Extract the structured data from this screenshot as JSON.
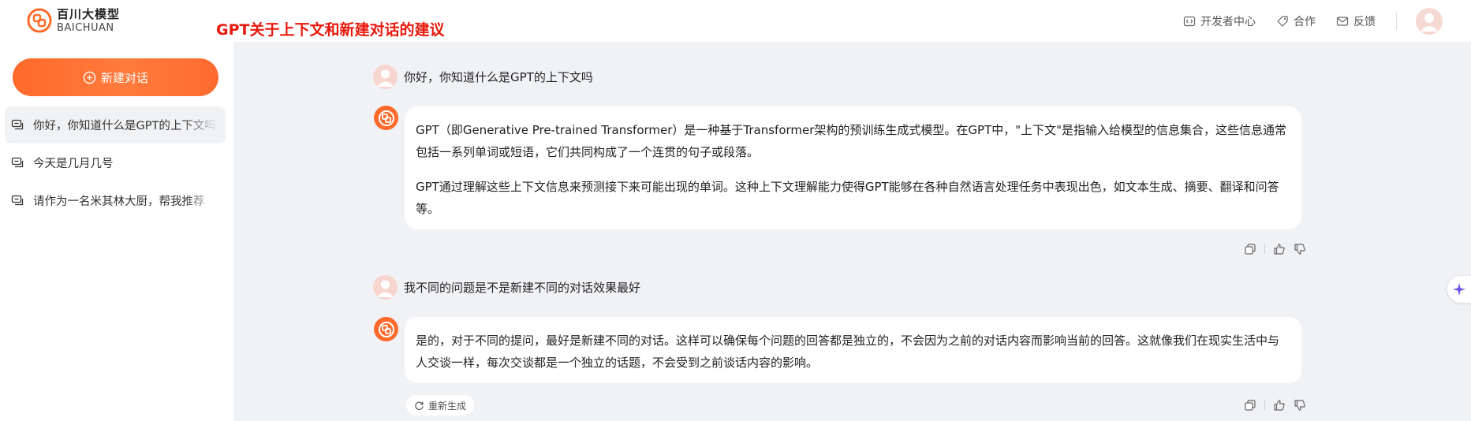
{
  "app": {
    "logo_cn": "百川大模型",
    "logo_en": "BAICHUAN",
    "brand_color": "#ff6a2b"
  },
  "page_title": "GPT关于上下文和新建对话的建议",
  "header": {
    "links": [
      {
        "label": "开发者中心",
        "icon": "code-icon"
      },
      {
        "label": "合作",
        "icon": "tag-icon"
      },
      {
        "label": "反馈",
        "icon": "mail-icon"
      }
    ]
  },
  "sidebar": {
    "new_chat_label": "新建对话",
    "conversations": [
      {
        "label": "你好，你知道什么是GPT的上下文吗",
        "active": true
      },
      {
        "label": "今天是几月几号",
        "active": false
      },
      {
        "label": "请作为一名米其林大厨，帮我推荐",
        "active": false
      }
    ]
  },
  "messages": [
    {
      "role": "user",
      "text": "你好，你知道什么是GPT的上下文吗"
    },
    {
      "role": "bot",
      "paragraphs": [
        "GPT（即Generative Pre-trained Transformer）是一种基于Transformer架构的预训练生成式模型。在GPT中，\"上下文\"是指输入给模型的信息集合，这些信息通常包括一系列单词或短语，它们共同构成了一个连贯的句子或段落。",
        "GPT通过理解这些上下文信息来预测接下来可能出现的单词。这种上下文理解能力使得GPT能够在各种自然语言处理任务中表现出色，如文本生成、摘要、翻译和问答等。"
      ]
    },
    {
      "role": "user",
      "text": "我不同的问题是不是新建不同的对话效果最好"
    },
    {
      "role": "bot",
      "paragraphs": [
        "是的，对于不同的提问，最好是新建不同的对话。这样可以确保每个问题的回答都是独立的，不会因为之前的对话内容而影响当前的回答。这就像我们在现实生活中与人交谈一样，每次交谈都是一个独立的话题，不会受到之前谈话内容的影响。"
      ]
    }
  ],
  "regenerate_label": "重新生成"
}
